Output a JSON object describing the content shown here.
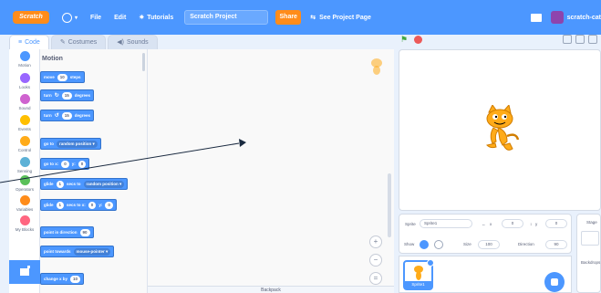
{
  "menu": {
    "logo": "Scratch",
    "file": "File",
    "edit": "Edit",
    "tutorials": "Tutorials",
    "project_name": "Scratch Project",
    "share": "Share",
    "see_project": "See Project Page",
    "username": "scratch-cat"
  },
  "tabs": {
    "code": "Code",
    "costumes": "Costumes",
    "sounds": "Sounds"
  },
  "categories": [
    {
      "label": "Motion",
      "color": "#4c97ff"
    },
    {
      "label": "Looks",
      "color": "#9966ff"
    },
    {
      "label": "Sound",
      "color": "#cf63cf"
    },
    {
      "label": "Events",
      "color": "#ffbf00"
    },
    {
      "label": "Control",
      "color": "#ffab19"
    },
    {
      "label": "Sensing",
      "color": "#5cb1d6"
    },
    {
      "label": "Operators",
      "color": "#59c059"
    },
    {
      "label": "Variables",
      "color": "#ff8c1a"
    },
    {
      "label": "My Blocks",
      "color": "#ff6680"
    }
  ],
  "palette": {
    "title": "Motion",
    "move": {
      "a": "move",
      "n": "10",
      "b": "steps"
    },
    "turn_right": {
      "a": "turn",
      "n": "15",
      "b": "degrees"
    },
    "turn_left": {
      "a": "turn",
      "n": "15",
      "b": "degrees"
    },
    "goto": {
      "a": "go to",
      "opt": "random position"
    },
    "goto_xy": {
      "a": "go to x:",
      "x": "0",
      "b": "y:",
      "y": "0"
    },
    "glide_to": {
      "a": "glide",
      "n": "1",
      "b": "secs to",
      "opt": "random position"
    },
    "glide_xy": {
      "a": "glide",
      "n": "1",
      "b": "secs to x:",
      "x": "0",
      "c": "y:",
      "y": "0"
    },
    "point_dir": {
      "a": "point in direction",
      "n": "90"
    },
    "point_towards": {
      "a": "point towards",
      "opt": "mouse-pointer"
    },
    "change_x": {
      "a": "change x by",
      "n": "10"
    }
  },
  "backpack": "Backpack",
  "sprite_info": {
    "sprite_label": "Sprite",
    "sprite_name": "Sprite1",
    "x_label": "x",
    "x_value": "0",
    "y_label": "y",
    "y_value": "0",
    "show_label": "Show",
    "size_label": "Size",
    "size_value": "100",
    "direction_label": "Direction",
    "direction_value": "90"
  },
  "sprite_list": {
    "tile_label": "Sprite1"
  },
  "stage_panel": {
    "label": "Stage",
    "backdrops": "Backdrops"
  }
}
